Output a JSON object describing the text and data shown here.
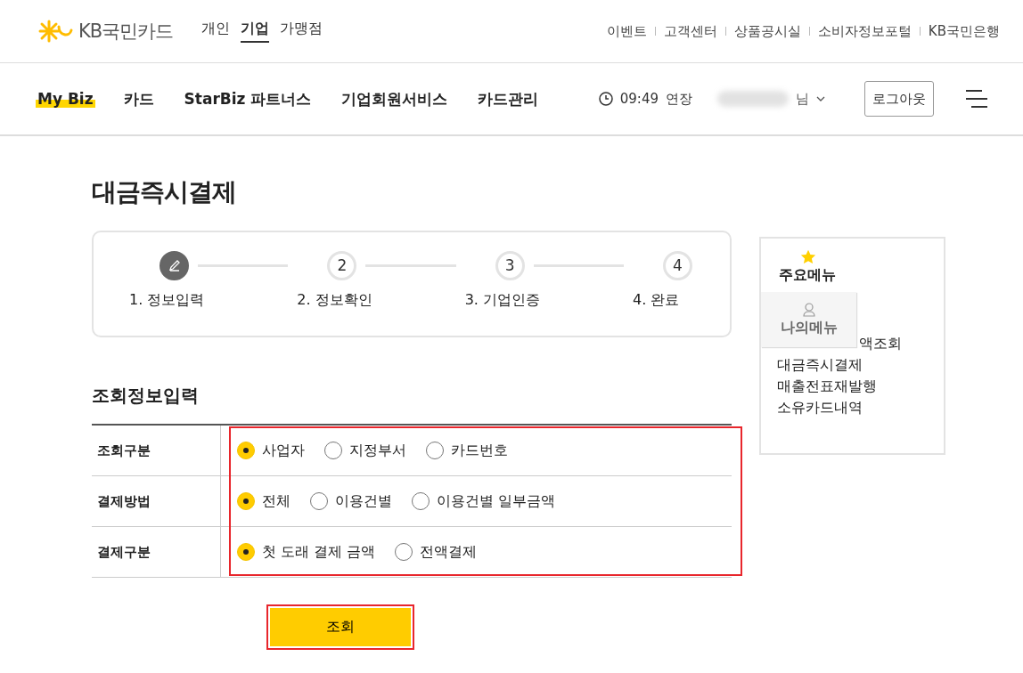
{
  "header": {
    "logo": "KB국민카드",
    "segments": [
      {
        "label": "개인",
        "selected": false
      },
      {
        "label": "기업",
        "selected": true
      },
      {
        "label": "가맹점",
        "selected": false
      }
    ],
    "utility_links": [
      "이벤트",
      "고객센터",
      "상품공시실",
      "소비자정보포털",
      "KB국민은행"
    ]
  },
  "nav": {
    "items": [
      {
        "label": "My Biz",
        "selected": true
      },
      {
        "label": "카드",
        "selected": false
      },
      {
        "label": "StarBiz 파트너스",
        "selected": false
      },
      {
        "label": "기업회원서비스",
        "selected": false
      },
      {
        "label": "카드관리",
        "selected": false
      }
    ],
    "session_time": "09:49",
    "extend": "연장",
    "user_suffix": "님",
    "logout": "로그아웃"
  },
  "page_title": "대금즉시결제",
  "steps": [
    {
      "label": "1. 정보입력",
      "current": true
    },
    {
      "number": "2",
      "label": "2. 정보확인",
      "current": false
    },
    {
      "number": "3",
      "label": "3. 기업인증",
      "current": false
    },
    {
      "number": "4",
      "label": "4. 완료",
      "current": false
    }
  ],
  "section_title": "조회정보입력",
  "form_rows": [
    {
      "label": "조회구분",
      "options": [
        {
          "label": "사업자",
          "selected": true
        },
        {
          "label": "지정부서",
          "selected": false
        },
        {
          "label": "카드번호",
          "selected": false
        }
      ]
    },
    {
      "label": "결제방법",
      "options": [
        {
          "label": "전체",
          "selected": true
        },
        {
          "label": "이용건별",
          "selected": false
        },
        {
          "label": "이용건별 일부금액",
          "selected": false
        }
      ]
    },
    {
      "label": "결제구분",
      "options": [
        {
          "label": "첫 도래 결제 금액",
          "selected": true
        },
        {
          "label": "전액결제",
          "selected": false
        }
      ]
    }
  ],
  "submit": "조회",
  "side_menu": {
    "title": "주요메뉴",
    "items": [
      "액조회",
      "대금즉시결제",
      "매출전표재발행",
      "소유카드내역"
    ],
    "overlay_tab": "나의메뉴"
  }
}
